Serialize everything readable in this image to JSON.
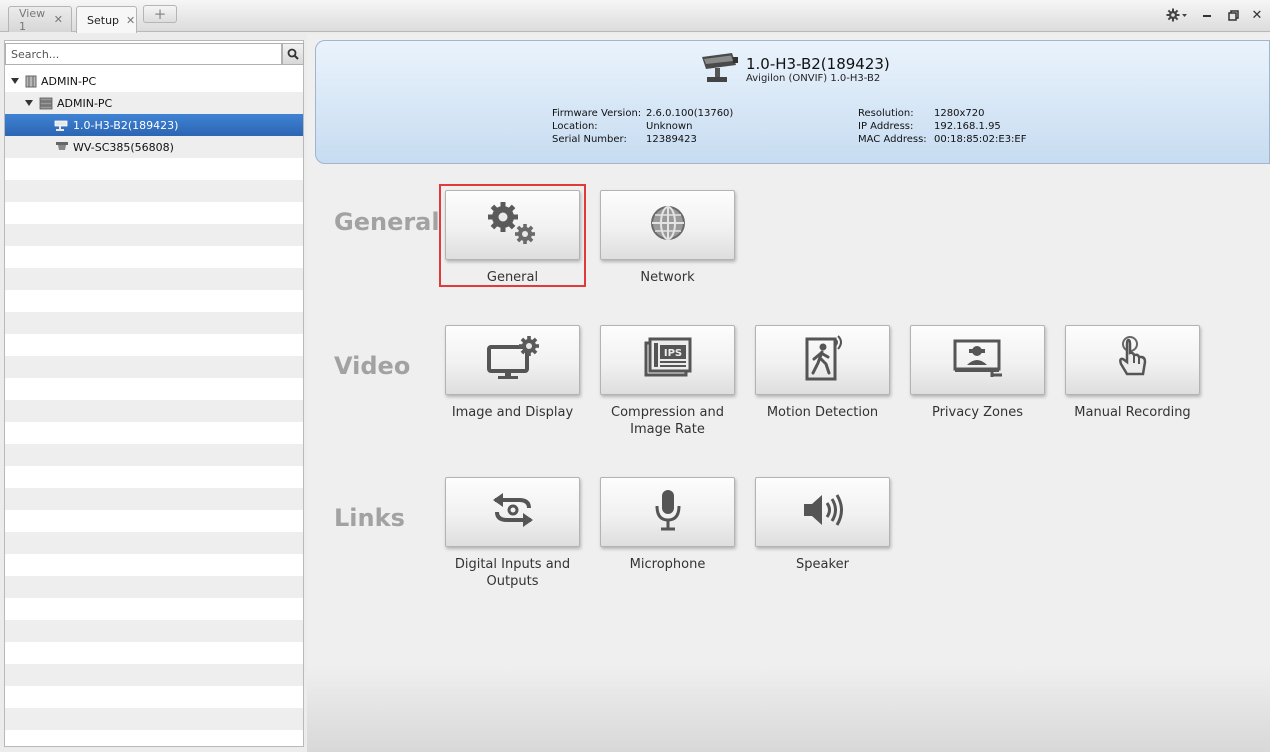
{
  "tabs": [
    {
      "label": "View 1",
      "active": false
    },
    {
      "label": "Setup",
      "active": true
    }
  ],
  "tab_add_label": "+",
  "window_controls": {
    "settings": "gear-dropdown-icon",
    "minimize": "minimize-icon",
    "restore": "restore-icon",
    "close": "close-icon"
  },
  "sidebar": {
    "search_placeholder": "Search...",
    "tree": [
      {
        "label": "ADMIN-PC",
        "level": 0,
        "icon": "site-icon",
        "expanded": true,
        "selected": false
      },
      {
        "label": "ADMIN-PC",
        "level": 1,
        "icon": "server-icon",
        "expanded": true,
        "selected": false
      },
      {
        "label": "1.0-H3-B2(189423)",
        "level": 2,
        "icon": "camera-icon",
        "selected": true
      },
      {
        "label": "WV-SC385(56808)",
        "level": 2,
        "icon": "dome-camera-icon",
        "selected": false
      }
    ]
  },
  "device": {
    "name": "1.0-H3-B2(189423)",
    "model": "Avigilon (ONVIF) 1.0-H3-B2",
    "info_left": [
      {
        "label": "Firmware Version:",
        "value": "2.6.0.100(13760)"
      },
      {
        "label": "Location:",
        "value": "Unknown"
      },
      {
        "label": "Serial Number:",
        "value": "12389423"
      }
    ],
    "info_right": [
      {
        "label": "Resolution:",
        "value": "1280x720"
      },
      {
        "label": "IP Address:",
        "value": "192.168.1.95"
      },
      {
        "label": "MAC Address:",
        "value": "00:18:85:02:E3:EF"
      }
    ]
  },
  "sections": [
    {
      "title": "General",
      "items": [
        {
          "label": "General",
          "icon": "gears-icon",
          "highlighted": true
        },
        {
          "label": "Network",
          "icon": "globe-icon"
        }
      ]
    },
    {
      "title": "Video",
      "items": [
        {
          "label": "Image and Display",
          "icon": "monitor-gear-icon"
        },
        {
          "label": "Compression and Image Rate",
          "icon": "ips-film-icon"
        },
        {
          "label": "Motion Detection",
          "icon": "walking-person-icon"
        },
        {
          "label": "Privacy Zones",
          "icon": "privacy-mask-icon"
        },
        {
          "label": "Manual Recording",
          "icon": "touch-hand-icon"
        }
      ]
    },
    {
      "title": "Links",
      "items": [
        {
          "label": "Digital Inputs and Outputs",
          "icon": "io-arrows-icon"
        },
        {
          "label": "Microphone",
          "icon": "microphone-icon"
        },
        {
          "label": "Speaker",
          "icon": "speaker-icon"
        }
      ]
    }
  ],
  "colors": {
    "selection": "#2f6dbd",
    "header_bg": "#d5e6f6",
    "highlight_border": "#e03a3a",
    "section_title": "#a2a2a2"
  }
}
